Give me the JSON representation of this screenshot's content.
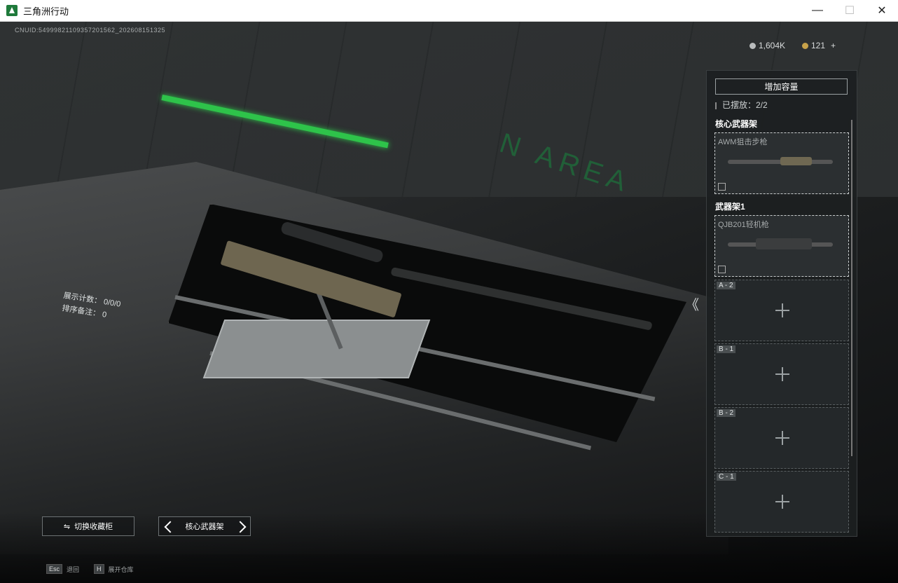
{
  "window": {
    "title": "三角洲行动",
    "minimize": "—",
    "maximize": "☐",
    "close": "✕"
  },
  "hud": {
    "uid": "CNUID:5499982110935720156​2_202608151325",
    "currency_silver": "1,604K",
    "currency_gold": "121",
    "currency_add": "+",
    "arrow_glyph": "《",
    "counter_label_1": "展示计数：",
    "counter_value_1": "0/0/0",
    "counter_label_2": "排序备注：",
    "counter_value_2": "0",
    "scene_text": "N AREA"
  },
  "panel": {
    "add_capacity": "增加容量",
    "placed": "已摆放：2/2",
    "core_rack_title": "核心武器架",
    "rack1_title": "武器架1",
    "slots_filled": [
      {
        "name": "AWM狙击步枪"
      },
      {
        "name": "QJB201轻机枪"
      }
    ],
    "slots_empty": [
      "A - 2",
      "B - 1",
      "B - 2",
      "C - 1"
    ]
  },
  "bottom": {
    "switch_cabinet": "切换收藏柜",
    "rack_selector": "核心武器架",
    "esc_key": "Esc",
    "esc_label": "退回",
    "h_key": "H",
    "h_label": "展开仓库"
  },
  "colors": {
    "accent_green": "#2ec34a",
    "rifle_tan": "#6e6650"
  }
}
